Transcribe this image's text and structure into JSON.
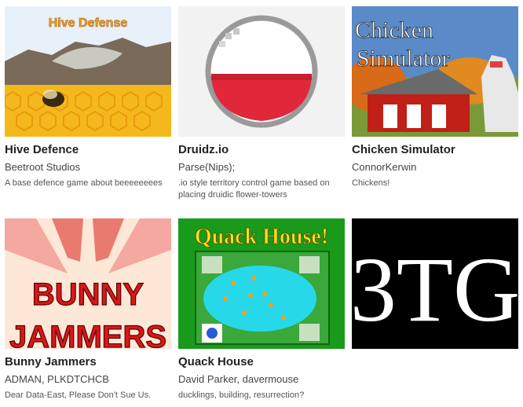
{
  "games": [
    {
      "title": "Hive Defence",
      "author": "Beetroot Studios",
      "description": "A base defence game about beeeeeeees",
      "thumb_text": "Hive Defense"
    },
    {
      "title": "Druidz.io",
      "author": "Parse(Nips);",
      "description": ".io style territory control game based on placing druidic flower-towers"
    },
    {
      "title": "Chicken Simulator",
      "author": "ConnorKerwin",
      "description": "Chickens!",
      "thumb_text": [
        "Chicken",
        "Simulator"
      ]
    },
    {
      "title": "Bunny Jammers",
      "author": "ADMAN, PLKDTCHCB",
      "description": "Dear Data-East, Please Don't Sue Us.",
      "thumb_text": [
        "BUNNY",
        "JAMMERS"
      ]
    },
    {
      "title": "Quack House",
      "author": "David Parker, davermouse",
      "description": "ducklings, building, resurrection?",
      "thumb_text": "Quack House!"
    },
    {
      "title": "",
      "author": "",
      "description": "",
      "thumb_text": "3TG"
    }
  ]
}
